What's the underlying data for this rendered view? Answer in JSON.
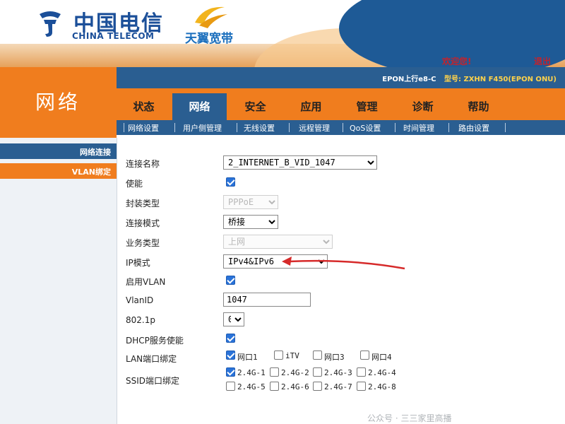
{
  "brand": {
    "cn": "中国电信",
    "en": "CHINA TELECOM",
    "sub": "天翼宽带"
  },
  "topbar": {
    "welcome": "欢迎您!",
    "logout": "退出",
    "device_model_prefix": "EPON上行e8-C",
    "device_model_label": "型号:",
    "device_model_value": "ZXHN F450(EPON ONU)"
  },
  "section_title": "网络",
  "main_nav": [
    {
      "label": "状态",
      "active": false
    },
    {
      "label": "网络",
      "active": true
    },
    {
      "label": "安全",
      "active": false
    },
    {
      "label": "应用",
      "active": false
    },
    {
      "label": "管理",
      "active": false
    },
    {
      "label": "诊断",
      "active": false
    },
    {
      "label": "帮助",
      "active": false
    }
  ],
  "sub_nav": [
    "网络设置",
    "用户侧管理",
    "无线设置",
    "远程管理",
    "QoS设置",
    "时间管理",
    "路由设置"
  ],
  "sidebar": {
    "items": [
      {
        "label": "网络连接"
      },
      {
        "label": "VLAN绑定"
      }
    ]
  },
  "form": {
    "connection_name": {
      "label": "连接名称",
      "value": "2_INTERNET_B_VID_1047"
    },
    "enable": {
      "label": "使能",
      "checked": true
    },
    "encap_type": {
      "label": "封装类型",
      "value": "PPPoE"
    },
    "conn_mode": {
      "label": "连接模式",
      "value": "桥接"
    },
    "service_type": {
      "label": "业务类型",
      "value": "上网"
    },
    "ip_mode": {
      "label": "IP模式",
      "value": "IPv4&IPv6"
    },
    "vlan_enable": {
      "label": "启用VLAN",
      "checked": true
    },
    "vlan_id": {
      "label": "VlanID",
      "value": "1047"
    },
    "dot1p": {
      "label": "802.1p",
      "value": "0"
    },
    "dhcp": {
      "label": "DHCP服务使能",
      "checked": true
    },
    "lan_bind": {
      "label": "LAN端口绑定",
      "ports": [
        {
          "label": "网口1",
          "checked": true
        },
        {
          "label": "iTV",
          "checked": false
        },
        {
          "label": "网口3",
          "checked": false
        },
        {
          "label": "网口4",
          "checked": false
        }
      ]
    },
    "ssid_bind": {
      "label": "SSID端口绑定",
      "ssids": [
        {
          "label": "2.4G-1",
          "checked": true
        },
        {
          "label": "2.4G-2",
          "checked": false
        },
        {
          "label": "2.4G-3",
          "checked": false
        },
        {
          "label": "2.4G-4",
          "checked": false
        },
        {
          "label": "2.4G-5",
          "checked": false
        },
        {
          "label": "2.4G-6",
          "checked": false
        },
        {
          "label": "2.4G-7",
          "checked": false
        },
        {
          "label": "2.4G-8",
          "checked": false
        }
      ]
    }
  },
  "watermark": "公众号 · 三三家里高播",
  "colors": {
    "orange": "#f07d1e",
    "blue": "#2a5e91",
    "brand_blue": "#1b4f99",
    "alert_red": "#c3232c"
  }
}
